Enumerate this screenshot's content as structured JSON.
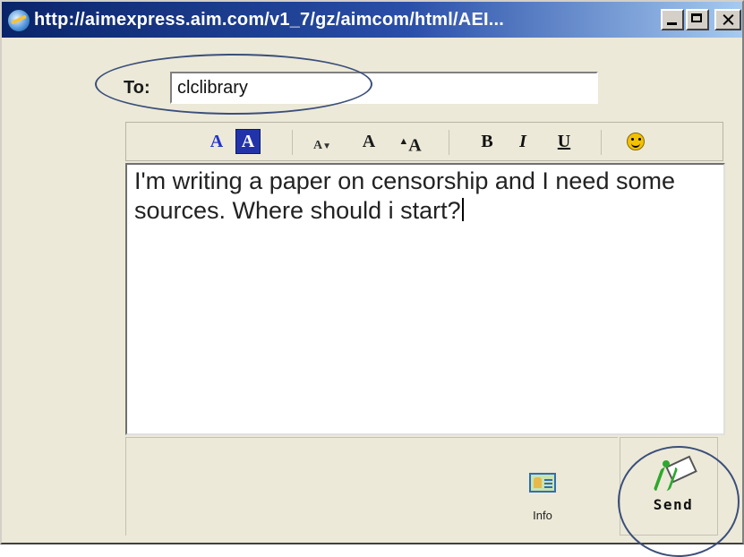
{
  "window": {
    "title": "http://aimexpress.aim.com/v1_7/gz/aimcom/html/AEI...",
    "buttons": {
      "minimize": "minimize",
      "maximize": "maximize",
      "close": "close"
    }
  },
  "compose": {
    "to_label": "To:",
    "to_value": "clclibrary",
    "message_text": "I'm writing a paper on censorship and I need some sources. Where should i start?"
  },
  "toolbar": {
    "font_color_glyph": "A",
    "background_color_glyph": "A",
    "smaller_text_glyph": "A",
    "normal_text_glyph": "A",
    "larger_text_glyph": "A",
    "bold_glyph": "B",
    "italic_glyph": "I",
    "underline_glyph": "U",
    "smiley_icon": "smiley-icon"
  },
  "actions": {
    "info_label": "Info",
    "send_label": "Send"
  },
  "colors": {
    "titlebar": "#0a246a",
    "annotation": "#3b4f7a",
    "panel": "#ece9d8"
  }
}
